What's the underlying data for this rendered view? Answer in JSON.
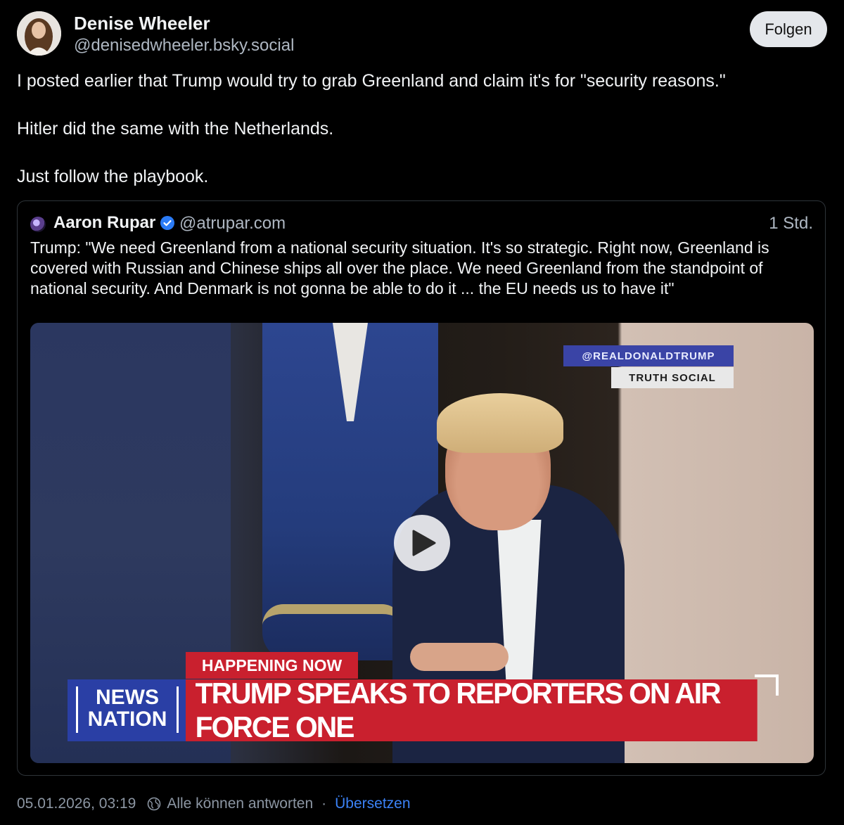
{
  "post": {
    "author": {
      "name": "Denise Wheeler",
      "handle": "@denisedwheeler.bsky.social"
    },
    "follow_label": "Folgen",
    "text": [
      "I posted earlier that Trump would try to grab Greenland and claim it's for \"security reasons.\"",
      "Hitler did the same with the Netherlands.",
      "Just follow the playbook."
    ],
    "quote": {
      "name": "Aaron Rupar",
      "handle": "@atrupar.com",
      "time": "1 Std.",
      "text": "Trump: \"We need Greenland from a national security situation. It's so strategic. Right now, Greenland is covered with Russian and Chinese ships all over the place. We need Greenland from the standpoint of national security. And Denmark is not gonna be able to do it ... the EU needs us to have it\"",
      "video": {
        "tag_handle": "@REALDONALDTRUMP",
        "tag_source": "TRUTH SOCIAL",
        "kicker": "HAPPENING NOW",
        "logo_line1": "NEWS",
        "logo_line2": "NATION",
        "headline": "TRUMP SPEAKS TO REPORTERS ON AIR FORCE ONE"
      }
    },
    "footer": {
      "timestamp": "05.01.2026, 03:19",
      "reply_setting": "Alle können antworten",
      "separator": "·",
      "translate_label": "Übersetzen"
    }
  },
  "colors": {
    "background": "#000000",
    "text": "#f1f3f5",
    "muted": "#aeb7c2",
    "link": "#3b82f6",
    "verified": "#2b7bf5",
    "banner_red": "#c9202e"
  },
  "icons": {
    "verified": "verified-check-icon",
    "play": "play-icon",
    "reply_setting": "globe-icon"
  }
}
